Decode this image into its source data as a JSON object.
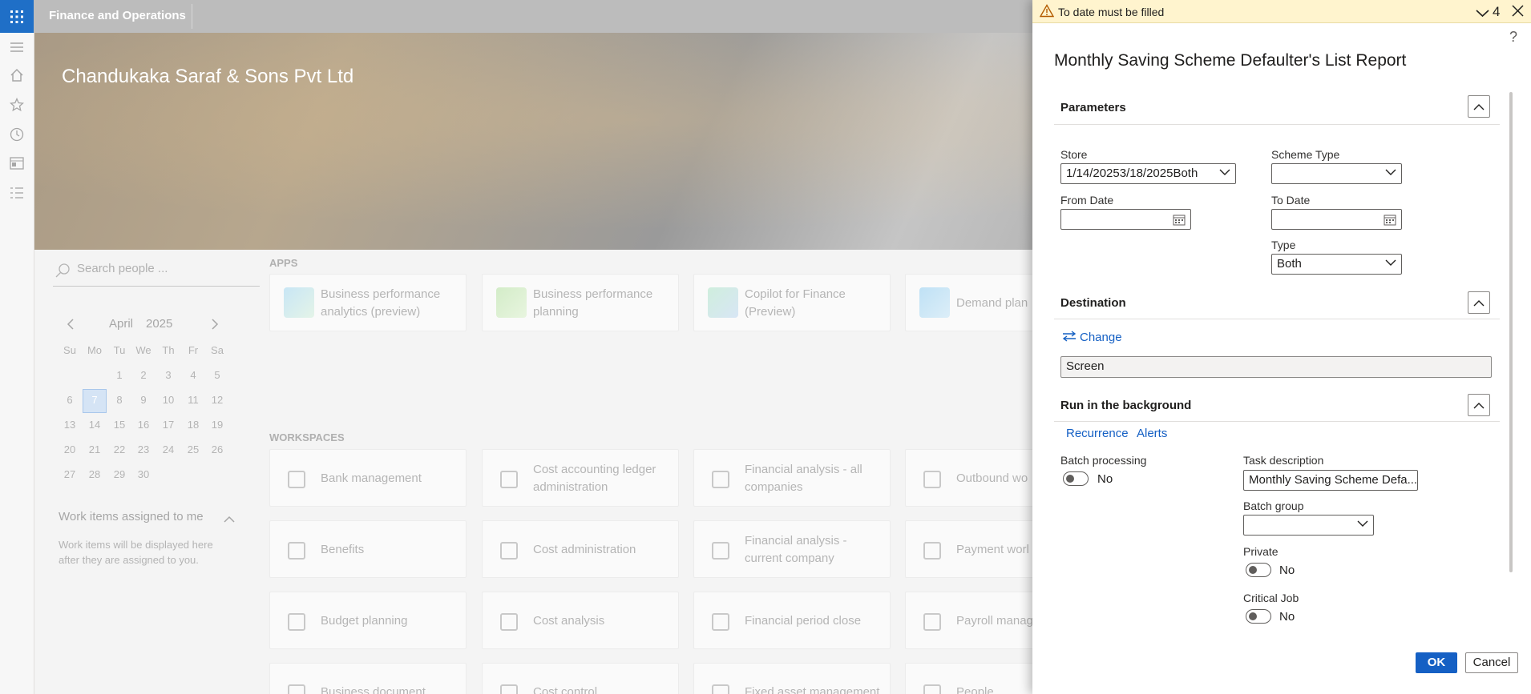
{
  "topbar": {
    "app_title": "Finance and Operations",
    "icon": "waffle-icon"
  },
  "rail": {
    "icons": [
      "hamburger-icon",
      "home-icon",
      "star-icon",
      "clock-icon",
      "workspace-icon",
      "list-icon"
    ]
  },
  "banner": {
    "company": "Chandukaka Saraf & Sons Pvt Ltd"
  },
  "search": {
    "placeholder": "Search people ..."
  },
  "calendar": {
    "month": "April",
    "year": "2025",
    "weekdays": [
      "Su",
      "Mo",
      "Tu",
      "We",
      "Th",
      "Fr",
      "Sa"
    ],
    "weeks": [
      [
        "",
        "",
        "1",
        "2",
        "3",
        "4",
        "5"
      ],
      [
        "6",
        "7",
        "8",
        "9",
        "10",
        "11",
        "12"
      ],
      [
        "13",
        "14",
        "15",
        "16",
        "17",
        "18",
        "19"
      ],
      [
        "20",
        "21",
        "22",
        "23",
        "24",
        "25",
        "26"
      ],
      [
        "27",
        "28",
        "29",
        "30",
        "",
        "",
        ""
      ]
    ],
    "selected": "7"
  },
  "work_items": {
    "title": "Work items assigned to me",
    "empty_text": "Work items will be displayed here after they are assigned to you."
  },
  "apps": {
    "label": "APPS",
    "tiles": [
      {
        "title": "Business performance analytics (preview)"
      },
      {
        "title": "Business performance planning"
      },
      {
        "title": "Copilot for Finance (Preview)"
      },
      {
        "title": "Demand plan"
      }
    ]
  },
  "workspaces": {
    "label": "WORKSPACES",
    "tiles": [
      {
        "title": "Bank management"
      },
      {
        "title": "Cost accounting ledger administration"
      },
      {
        "title": "Financial analysis - all companies"
      },
      {
        "title": "Outbound wo"
      },
      {
        "title": "Benefits"
      },
      {
        "title": "Cost administration"
      },
      {
        "title": "Financial analysis - current company"
      },
      {
        "title": "Payment worl"
      },
      {
        "title": "Budget planning"
      },
      {
        "title": "Cost analysis"
      },
      {
        "title": "Financial period close"
      },
      {
        "title": "Payroll manag"
      },
      {
        "title": "Business document"
      },
      {
        "title": "Cost control"
      },
      {
        "title": "Fixed asset management"
      },
      {
        "title": "People"
      }
    ]
  },
  "dialog": {
    "message": {
      "text": "To date must be filled",
      "count": "4"
    },
    "help": "?",
    "title": "Monthly Saving Scheme Defaulter's List Report",
    "parameters": {
      "heading": "Parameters",
      "store_label": "Store",
      "store_value": "1/14/20253/18/2025Both",
      "scheme_type_label": "Scheme Type",
      "scheme_type_value": "",
      "from_date_label": "From Date",
      "from_date_value": "",
      "to_date_label": "To Date",
      "to_date_value": "",
      "type_label": "Type",
      "type_value": "Both"
    },
    "destination": {
      "heading": "Destination",
      "change_label": "Change",
      "value": "Screen"
    },
    "background": {
      "heading": "Run in the background",
      "recurrence": "Recurrence",
      "alerts": "Alerts",
      "batch_label": "Batch processing",
      "batch_value": "No",
      "task_label": "Task description",
      "task_value": "Monthly Saving Scheme Defa...",
      "batch_group_label": "Batch group",
      "batch_group_value": "",
      "private_label": "Private",
      "private_value": "No",
      "critical_label": "Critical Job",
      "critical_value": "No"
    },
    "ok": "OK",
    "cancel": "Cancel"
  },
  "colors": {
    "accent": "#1560c4",
    "warning_bg": "#fff4ce",
    "waffle": "#1f6fc7"
  }
}
